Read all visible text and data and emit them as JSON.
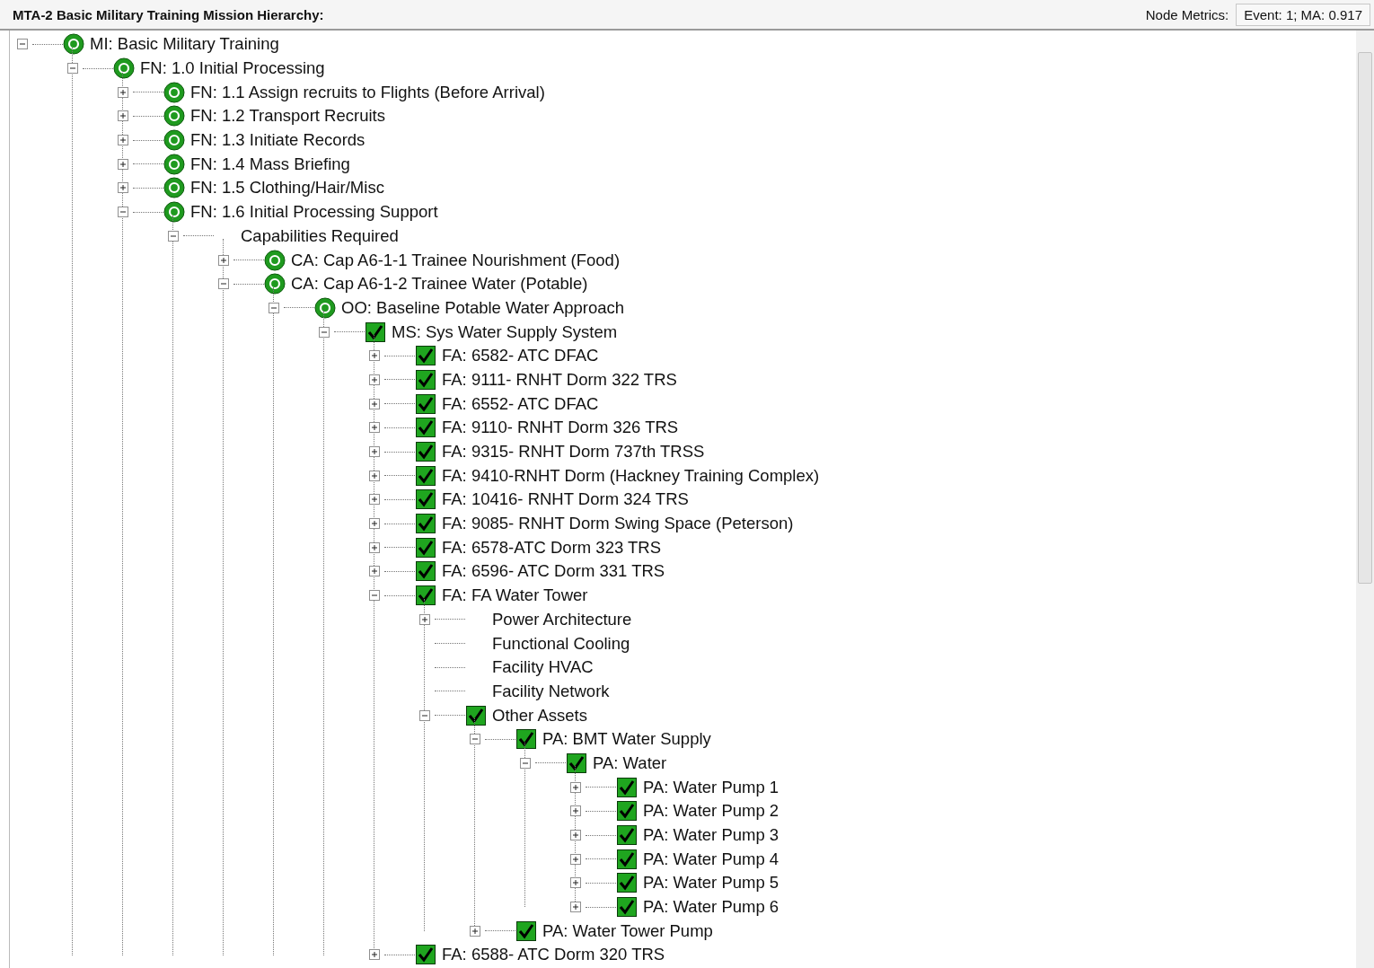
{
  "title": "MTA-2 Basic Military Training Mission Hierarchy:",
  "metrics": {
    "label": "Node Metrics:",
    "value": "Event: 1;  MA: 0.917"
  },
  "tree": [
    {
      "label": "MI: Basic Military Training",
      "kind": "target",
      "expanded": true,
      "children": [
        {
          "label": "FN: 1.0 Initial Processing",
          "kind": "target",
          "expanded": true,
          "children": [
            {
              "label": "FN: 1.1 Assign recruits to Flights (Before Arrival)",
              "kind": "target",
              "expanded": false
            },
            {
              "label": "FN: 1.2 Transport Recruits",
              "kind": "target",
              "expanded": false
            },
            {
              "label": "FN: 1.3  Initiate Records",
              "kind": "target",
              "expanded": false
            },
            {
              "label": "FN: 1.4 Mass Briefing",
              "kind": "target",
              "expanded": false
            },
            {
              "label": "FN: 1.5 Clothing/Hair/Misc",
              "kind": "target",
              "expanded": false
            },
            {
              "label": "FN: 1.6 Initial Processing Support",
              "kind": "target",
              "expanded": true,
              "children": [
                {
                  "label": "Capabilities Required",
                  "expanded": true,
                  "children": [
                    {
                      "label": "CA: Cap A6-1-1 Trainee Nourishment (Food)",
                      "kind": "target",
                      "expanded": false
                    },
                    {
                      "label": "CA: Cap A6-1-2 Trainee Water (Potable)",
                      "kind": "target",
                      "expanded": true,
                      "children": [
                        {
                          "label": "OO: Baseline Potable Water Approach",
                          "kind": "target",
                          "expanded": true,
                          "children": [
                            {
                              "label": "MS: Sys Water Supply System",
                              "kind": "check",
                              "expanded": true,
                              "children": [
                                {
                                  "label": "FA: 6582- ATC DFAC",
                                  "kind": "check",
                                  "expanded": false
                                },
                                {
                                  "label": "FA: 9111- RNHT Dorm 322 TRS",
                                  "kind": "check",
                                  "expanded": false
                                },
                                {
                                  "label": "FA: 6552- ATC DFAC",
                                  "kind": "check",
                                  "expanded": false
                                },
                                {
                                  "label": "FA: 9110- RNHT Dorm 326 TRS",
                                  "kind": "check",
                                  "expanded": false
                                },
                                {
                                  "label": "FA: 9315- RNHT Dorm 737th TRSS",
                                  "kind": "check",
                                  "expanded": false
                                },
                                {
                                  "label": "FA: 9410-RNHT Dorm (Hackney Training Complex)",
                                  "kind": "check",
                                  "expanded": false
                                },
                                {
                                  "label": "FA: 10416- RNHT Dorm 324 TRS",
                                  "kind": "check",
                                  "expanded": false
                                },
                                {
                                  "label": "FA: 9085- RNHT Dorm Swing Space (Peterson)",
                                  "kind": "check",
                                  "expanded": false
                                },
                                {
                                  "label": "FA: 6578-ATC Dorm 323 TRS",
                                  "kind": "check",
                                  "expanded": false
                                },
                                {
                                  "label": "FA: 6596- ATC Dorm 331 TRS",
                                  "kind": "check",
                                  "expanded": false
                                },
                                {
                                  "label": "FA: FA Water Tower",
                                  "kind": "check",
                                  "expanded": true,
                                  "children": [
                                    {
                                      "label": "Power Architecture",
                                      "expanded": false
                                    },
                                    {
                                      "label": "Functional Cooling"
                                    },
                                    {
                                      "label": "Facility HVAC"
                                    },
                                    {
                                      "label": "Facility Network"
                                    },
                                    {
                                      "label": "Other Assets",
                                      "kind": "check",
                                      "expanded": true,
                                      "children": [
                                        {
                                          "label": "PA: BMT Water Supply",
                                          "kind": "check",
                                          "expanded": true,
                                          "children": [
                                            {
                                              "label": "PA: Water",
                                              "kind": "check",
                                              "expanded": true,
                                              "children": [
                                                {
                                                  "label": "PA: Water Pump 1",
                                                  "kind": "check",
                                                  "expanded": false
                                                },
                                                {
                                                  "label": "PA: Water Pump 2",
                                                  "kind": "check",
                                                  "expanded": false
                                                },
                                                {
                                                  "label": "PA: Water Pump 3",
                                                  "kind": "check",
                                                  "expanded": false
                                                },
                                                {
                                                  "label": "PA: Water Pump 4",
                                                  "kind": "check",
                                                  "expanded": false
                                                },
                                                {
                                                  "label": "PA: Water Pump 5",
                                                  "kind": "check",
                                                  "expanded": false
                                                },
                                                {
                                                  "label": "PA: Water Pump 6",
                                                  "kind": "check",
                                                  "expanded": false
                                                }
                                              ]
                                            }
                                          ]
                                        },
                                        {
                                          "label": "PA: Water Tower Pump",
                                          "kind": "check",
                                          "expanded": false
                                        }
                                      ]
                                    }
                                  ]
                                },
                                {
                                  "label": "FA: 6588- ATC Dorm 320 TRS",
                                  "kind": "check",
                                  "expanded": false
                                }
                              ]
                            }
                          ]
                        }
                      ]
                    }
                  ]
                }
              ]
            }
          ]
        }
      ]
    }
  ]
}
